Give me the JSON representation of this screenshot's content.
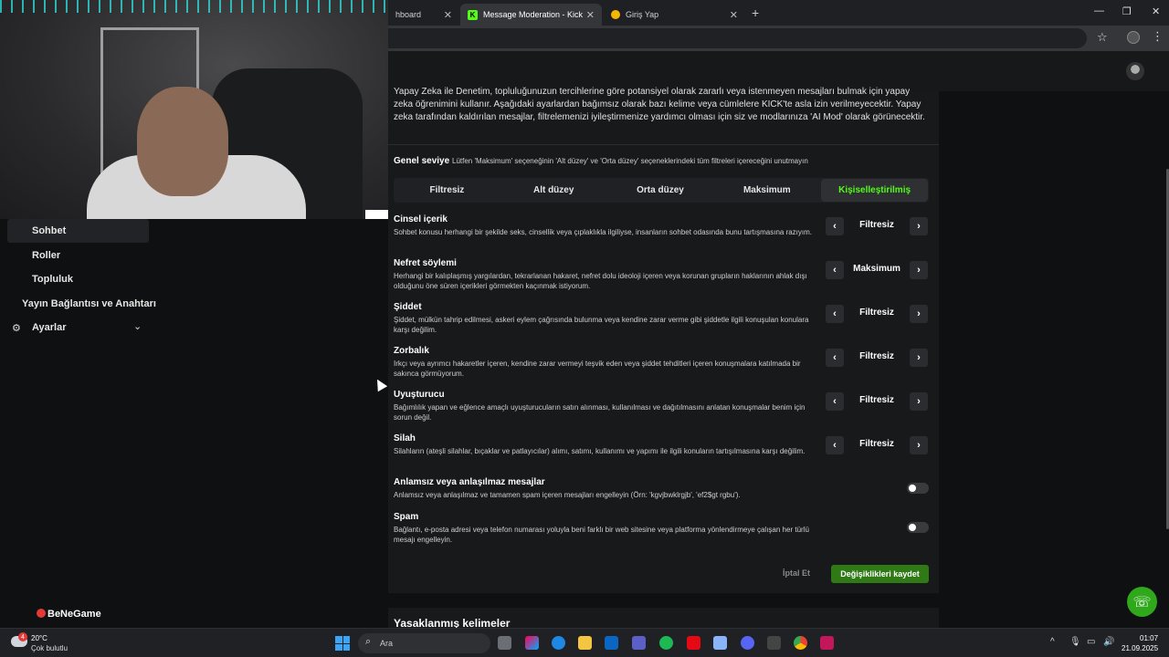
{
  "browser": {
    "tabs": [
      {
        "label": "hboard",
        "active": false
      },
      {
        "label": "Message Moderation - Kick Das",
        "active": true
      },
      {
        "label": "Giriş Yap",
        "active": false
      }
    ],
    "new_tab": "+",
    "close": "✕",
    "window_controls": [
      "—",
      "❐",
      "✕"
    ]
  },
  "sidebar": {
    "items": [
      {
        "label": "Sohbet",
        "active": true
      },
      {
        "label": "Roller",
        "active": false
      },
      {
        "label": "Topluluk",
        "active": false
      },
      {
        "label": "Yayın Bağlantısı ve Anahtarı",
        "active": false
      },
      {
        "label": "Ayarlar",
        "active": false
      }
    ]
  },
  "watermark": "BeNeGame",
  "moderation": {
    "intro": "Yapay Zeka ile Denetim, topluluğunuzun tercihlerine göre potansiyel olarak zararlı veya istenmeyen mesajları bulmak için yapay zeka öğrenimini kullanır. Aşağıdaki ayarlardan bağımsız olarak bazı kelime veya cümlelere KICK'te asla izin verilmeyecektir. Yapay zeka tarafından kaldırılan mesajlar, filtrelemenizi iyileştirmenize yardımcı olması için siz ve modlarınıza 'AI Mod' olarak görünecektir.",
    "general_level_label": "Genel seviye",
    "general_level_hint": "Lütfen 'Maksimum' seçeneğinin 'Alt düzey' ve 'Orta düzey' seçeneklerindeki tüm filtreleri içereceğini unutmayın",
    "levels": [
      "Filtresiz",
      "Alt düzey",
      "Orta düzey",
      "Maksimum",
      "Kişiselleştirilmiş"
    ],
    "selected_level": "Kişiselleştirilmiş",
    "categories": [
      {
        "title": "Cinsel içerik",
        "desc": "Sohbet konusu herhangi bir şekilde seks, cinsellik veya çıplaklıkla ilgiliyse, insanların sohbet odasında bunu tartışmasına razıyım.",
        "value": "Filtresiz"
      },
      {
        "title": "Nefret söylemi",
        "desc": "Herhangi bir kalıplaşmış yargılardan, tekrarlanan hakaret, nefret dolu ideoloji içeren veya korunan grupların haklarının ahlak dışı olduğunu öne süren içerikleri görmekten kaçınmak istiyorum.",
        "value": "Maksimum"
      },
      {
        "title": "Şiddet",
        "desc": "Şiddet, mülkün tahrip edilmesi, askeri eylem çağrısında bulunma veya kendine zarar verme gibi şiddetle ilgili konuşulan konulara karşı değilim.",
        "value": "Filtresiz"
      },
      {
        "title": "Zorbalık",
        "desc": "Irkçı veya ayrımcı hakaretler içeren, kendine zarar vermeyi teşvik eden veya şiddet tehditleri içeren konuşmalara katılmada bir sakınca görmüyorum.",
        "value": "Filtresiz"
      },
      {
        "title": "Uyuşturucu",
        "desc": "Bağımlılık yapan ve eğlence amaçlı uyuşturucuların satın alınması, kullanılması ve dağıtılmasını anlatan konuşmalar benim için sorun değil.",
        "value": "Filtresiz"
      },
      {
        "title": "Silah",
        "desc": "Silahların (ateşli silahlar, bıçaklar ve patlayıcılar) alımı, satımı, kullanımı ve yapımı ile ilgili konuların tartışılmasına karşı değilim.",
        "value": "Filtresiz"
      }
    ],
    "toggles": [
      {
        "title": "Anlamsız veya anlaşılmaz mesajlar",
        "desc": "Anlamsız veya anlaşılmaz ve tamamen spam içeren mesajları engelleyin (Örn: 'kgvjbwklrgjb', 'ef2$gt rgbu').",
        "on": false
      },
      {
        "title": "Spam",
        "desc": "Bağlantı, e-posta adresi veya telefon numarası yoluyla beni farklı bir web sitesine veya platforma yönlendirmeye çalışan her türlü mesajı engelleyin.",
        "on": false
      }
    ],
    "cancel_label": "İptal Et",
    "save_label": "Değişiklikleri kaydet",
    "next_section": "Yasaklanmış kelimeler"
  },
  "taskbar": {
    "weather_temp": "20°C",
    "weather_cond": "Çok bulutlu",
    "weather_badge": "4",
    "search_placeholder": "Ara",
    "time": "01:07",
    "date": "21.09.2025"
  },
  "colors": {
    "accent": "#53fc18",
    "save_button": "#2f7a14",
    "panel": "#18191b"
  }
}
